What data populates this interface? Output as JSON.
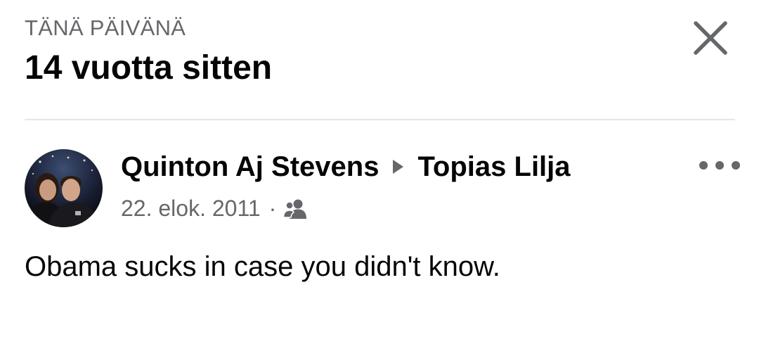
{
  "header": {
    "kicker": "TÄNÄ PÄIVÄNÄ",
    "title": "14 vuotta sitten"
  },
  "post": {
    "author": "Quinton Aj Stevens",
    "recipient": "Topias Lilja",
    "date": "22. elok. 2011",
    "separator": "·",
    "audience_icon": "friends-icon",
    "text": "Obama sucks in case you didn't know."
  },
  "colors": {
    "primary_text": "#050505",
    "secondary_text": "#65676b",
    "divider": "#e4e6eb",
    "background": "#ffffff"
  }
}
